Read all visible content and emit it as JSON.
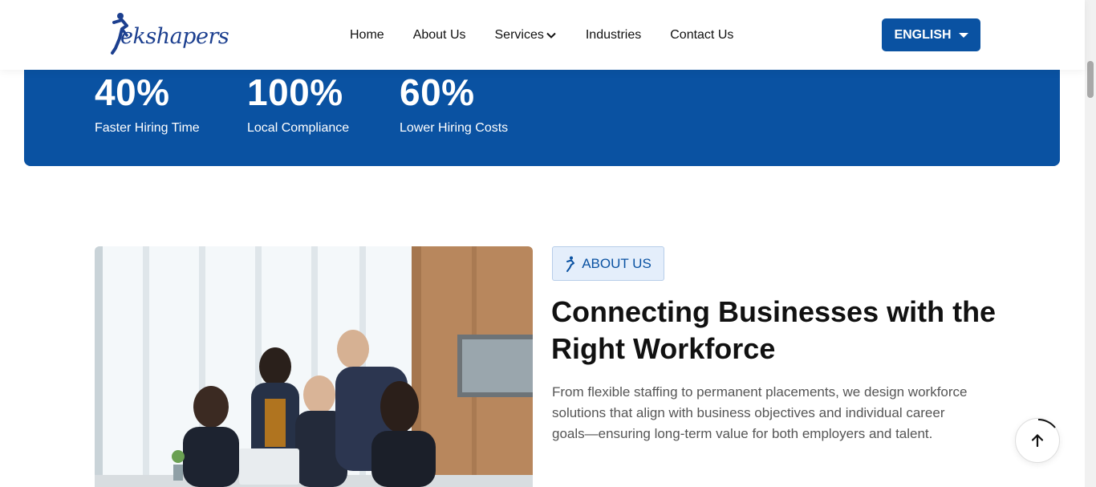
{
  "header": {
    "logo_text": "ekshapers",
    "nav": [
      {
        "label": "Home"
      },
      {
        "label": "About Us"
      },
      {
        "label": "Services"
      },
      {
        "label": "Industries"
      },
      {
        "label": "Contact Us"
      }
    ],
    "language_label": "ENGLISH"
  },
  "stats": [
    {
      "value": "40%",
      "label": "Faster Hiring Time"
    },
    {
      "value": "100%",
      "label": "Local Compliance"
    },
    {
      "value": "60%",
      "label": "Lower Hiring Costs"
    }
  ],
  "about": {
    "badge": "ABOUT US",
    "title": "Connecting Businesses with the Right Workforce",
    "text": "From flexible staffing to permanent placements, we design workforce solutions that align with business objectives and individual career goals—ensuring long-term value for both employers and talent."
  },
  "colors": {
    "brand_blue": "#0a52a2",
    "badge_bg": "#e4eefb"
  }
}
